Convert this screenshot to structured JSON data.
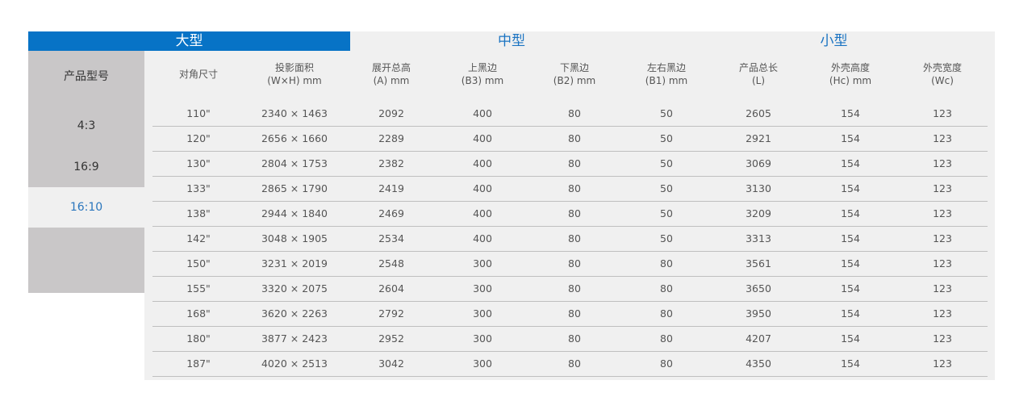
{
  "tabs": [
    "大型",
    "中型",
    "小型"
  ],
  "sidebar": {
    "header": "产品型号",
    "items": [
      "4:3",
      "16:9",
      "16:10"
    ]
  },
  "columns": [
    [
      "对角尺寸"
    ],
    [
      "投影面积",
      "(W×H) mm"
    ],
    [
      "展开总高",
      "(A) mm"
    ],
    [
      "上黑边",
      "(B3) mm"
    ],
    [
      "下黑边",
      "(B2) mm"
    ],
    [
      "左右黑边",
      "(B1) mm"
    ],
    [
      "产品总长",
      "(L)"
    ],
    [
      "外壳高度",
      "(Hc) mm"
    ],
    [
      "外壳宽度",
      "(Wc)"
    ]
  ],
  "rows": [
    [
      "110\"",
      "2340 × 1463",
      "2092",
      "400",
      "80",
      "50",
      "2605",
      "154",
      "123"
    ],
    [
      "120\"",
      "2656 × 1660",
      "2289",
      "400",
      "80",
      "50",
      "2921",
      "154",
      "123"
    ],
    [
      "130\"",
      "2804 × 1753",
      "2382",
      "400",
      "80",
      "50",
      "3069",
      "154",
      "123"
    ],
    [
      "133\"",
      "2865 × 1790",
      "2419",
      "400",
      "80",
      "50",
      "3130",
      "154",
      "123"
    ],
    [
      "138\"",
      "2944 × 1840",
      "2469",
      "400",
      "80",
      "50",
      "3209",
      "154",
      "123"
    ],
    [
      "142\"",
      "3048 × 1905",
      "2534",
      "400",
      "80",
      "50",
      "3313",
      "154",
      "123"
    ],
    [
      "150\"",
      "3231 × 2019",
      "2548",
      "300",
      "80",
      "80",
      "3561",
      "154",
      "123"
    ],
    [
      "155\"",
      "3320 × 2075",
      "2604",
      "300",
      "80",
      "80",
      "3650",
      "154",
      "123"
    ],
    [
      "168\"",
      "3620 × 2263",
      "2792",
      "300",
      "80",
      "80",
      "3950",
      "154",
      "123"
    ],
    [
      "180\"",
      "3877 × 2423",
      "2952",
      "300",
      "80",
      "80",
      "4207",
      "154",
      "123"
    ],
    [
      "187\"",
      "4020 × 2513",
      "3042",
      "300",
      "80",
      "80",
      "4350",
      "154",
      "123"
    ]
  ]
}
